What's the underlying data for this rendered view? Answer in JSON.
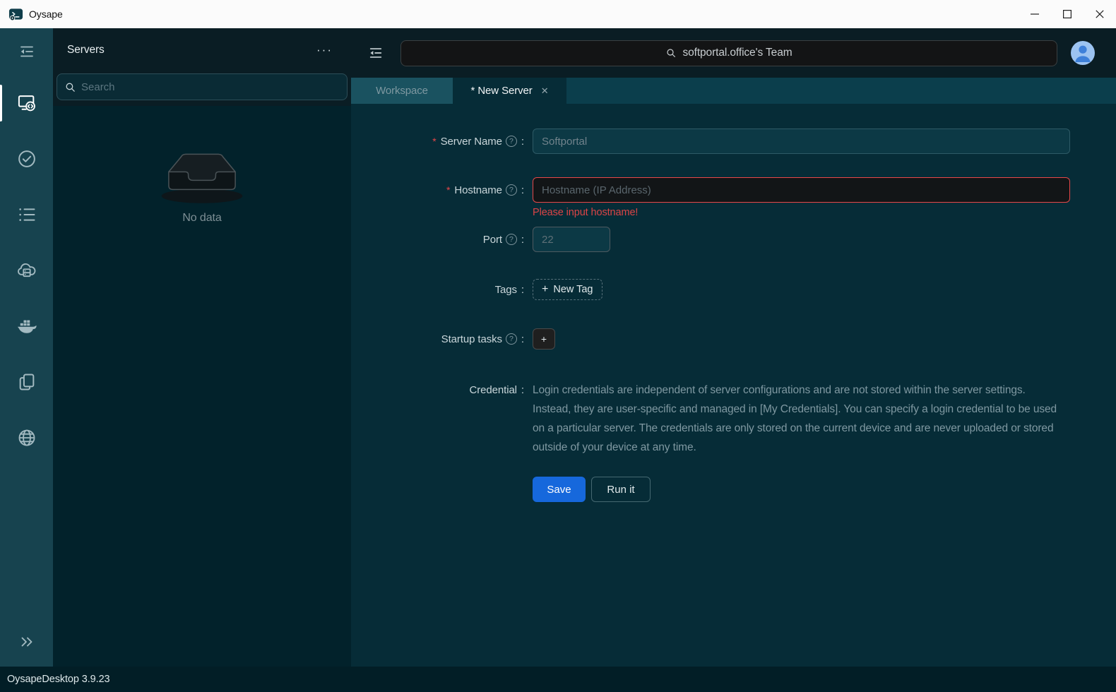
{
  "titlebar": {
    "app_name": "Oysape"
  },
  "header": {
    "team_text": "softportal.office's Team"
  },
  "sidebar": {
    "items": [
      {
        "icon": "menu-fold"
      },
      {
        "icon": "remote-server",
        "active": true
      },
      {
        "icon": "check-circle"
      },
      {
        "icon": "unordered-list"
      },
      {
        "icon": "cloud-server"
      },
      {
        "icon": "docker-whale"
      },
      {
        "icon": "files-copy"
      },
      {
        "icon": "globe"
      },
      {
        "icon": "double-chevron-right"
      }
    ]
  },
  "servers_panel": {
    "title": "Servers",
    "search_placeholder": "Search",
    "empty_text": "No data"
  },
  "tabs": [
    {
      "label": "Workspace",
      "active": false
    },
    {
      "label": "* New Server",
      "active": true,
      "closable": true
    }
  ],
  "form": {
    "required_mark": "*",
    "colon": ":",
    "server_name": {
      "label": "Server Name",
      "value": "",
      "placeholder": "Softportal"
    },
    "hostname": {
      "label": "Hostname",
      "value": "",
      "placeholder": "Hostname (IP Address)",
      "error": "Please input hostname!"
    },
    "port": {
      "label": "Port",
      "value": "",
      "placeholder": "22"
    },
    "tags": {
      "label": "Tags",
      "add_label": "New Tag"
    },
    "startup_tasks": {
      "label": "Startup tasks",
      "add_label": "+"
    },
    "credential": {
      "label": "Credential",
      "description": "Login credentials are independent of server configurations and are not stored within the server settings. Instead, they are user-specific and managed in [My Credentials]. You can specify a login credential to be used on a particular server. The credentials are only stored on the current device and are never uploaded or stored outside of your device at any time."
    },
    "save_label": "Save",
    "run_label": "Run it"
  },
  "icons": {
    "more": "···",
    "close": "✕",
    "plus": "+",
    "question": "?"
  },
  "statusbar": {
    "text": "OysapeDesktop 3.9.23"
  },
  "colors": {
    "accent_blue": "#1668DC",
    "error_red": "#DC4446",
    "sidebar_bg": "#17434F",
    "header_bg": "#0A1D24",
    "panel_bg": "#02222B",
    "tabstrip_bg": "#0B3E4C",
    "tab_inactive_bg": "#1A5260",
    "content_bg": "#062C37",
    "status_bg": "#021E26",
    "input_teal_bg": "#0C3945",
    "avatar_bg": "#9CC3F1",
    "avatar_person": "#3E80D9"
  }
}
